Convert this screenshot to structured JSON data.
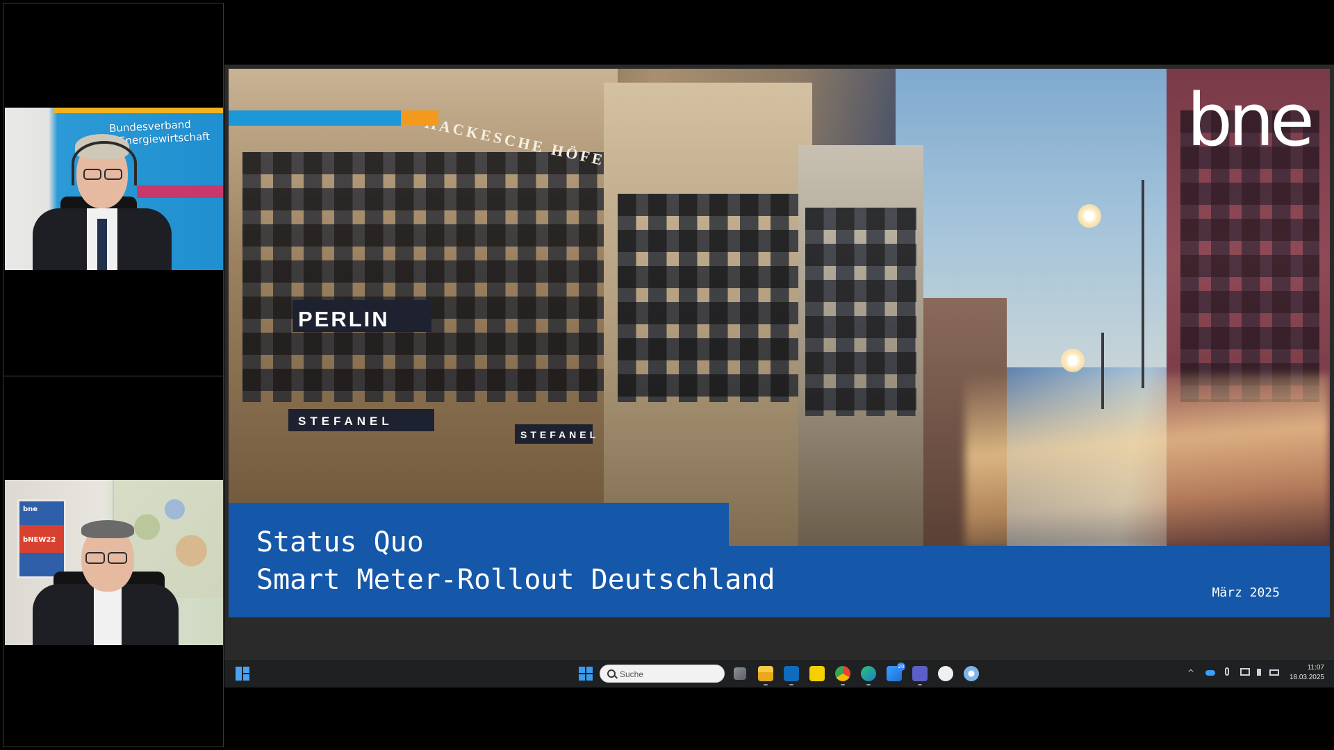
{
  "participants": {
    "tile1": {
      "rollup_line1": "Bundesverband",
      "rollup_line2": "e Energiewirtschaft"
    },
    "tile2": {
      "poster_line1": "bne",
      "poster_line2": "bNEW22"
    }
  },
  "slide": {
    "logo": "bne",
    "title_line1": "Status Quo",
    "title_line2": "Smart Meter-Rollout Deutschland",
    "date": "März 2025",
    "photo_signs": {
      "perlin": "PERLIN",
      "stefanel": "STEFANEL",
      "stefanel2": "STEFANEL",
      "arch": "HACKESCHE HÖFE"
    },
    "colors": {
      "brand_blue": "#1557a8",
      "accent_blue": "#1e97d8",
      "accent_orange": "#f39a1e"
    }
  },
  "taskbar": {
    "search_placeholder": "Suche",
    "teams_badge": "20",
    "clock_time": "11:07",
    "clock_date": "18.03.2025",
    "icons": [
      "widgets-icon",
      "start-icon",
      "search-icon",
      "task-view-icon",
      "file-explorer-icon",
      "outlook-icon",
      "sticky-notes-icon",
      "chrome-icon",
      "edge-icon",
      "feedback-icon",
      "teams-icon",
      "pm-app-icon",
      "settings-app-icon",
      "tray-chevron-icon",
      "onedrive-icon",
      "microphone-icon",
      "network-icon",
      "volume-icon",
      "battery-icon"
    ]
  }
}
